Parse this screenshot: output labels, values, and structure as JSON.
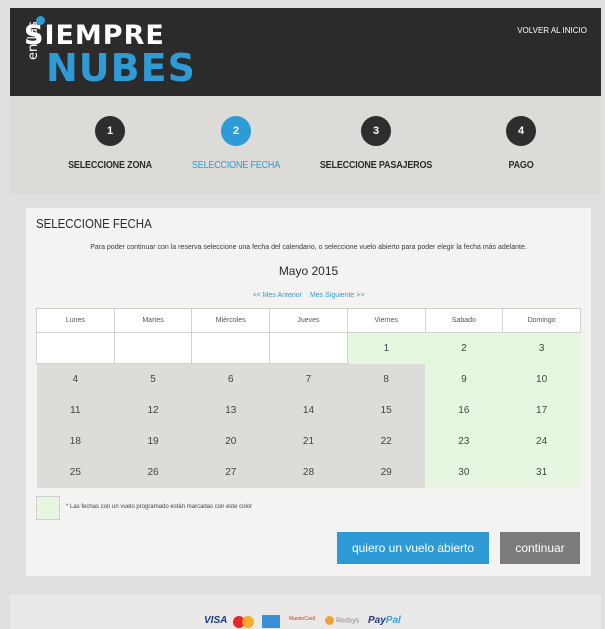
{
  "header": {
    "logo_line1": "SIEMPRE",
    "logo_small": "en las",
    "logo_line2": "NUBES",
    "back_link": "VOLVER AL INICIO"
  },
  "steps": [
    {
      "number": "1",
      "label": "SELECCIONE ZONA"
    },
    {
      "number": "2",
      "label": "SELECCIONE FECHA"
    },
    {
      "number": "3",
      "label": "SELECCIONE PASAJEROS"
    },
    {
      "number": "4",
      "label": "PAGO"
    }
  ],
  "card": {
    "title": "SELECCIONE FECHA",
    "description": "Para poder continuar con la reserva seleccione una fecha del calendario, o seleccione vuelo abierto para poder elegir la fecha más adelante.",
    "month": "Mayo 2015",
    "prev_month": "<< Mes Anterior",
    "next_month": "Mes Siguiente >>"
  },
  "calendar": {
    "weekdays": [
      "Lunes",
      "Martes",
      "Miércoles",
      "Jueves",
      "Viernes",
      "Sabado",
      "Domingo"
    ],
    "days": [
      "1",
      "2",
      "3",
      "4",
      "5",
      "6",
      "7",
      "8",
      "9",
      "10",
      "11",
      "12",
      "13",
      "14",
      "15",
      "16",
      "17",
      "18",
      "19",
      "20",
      "21",
      "22",
      "23",
      "24",
      "25",
      "26",
      "27",
      "28",
      "29",
      "30",
      "31"
    ]
  },
  "legend": {
    "text": "* Las fechas con un vuelo programado están marcadas con este color"
  },
  "buttons": {
    "open_flight": "quiero un vuelo abierto",
    "continue": "continuar"
  },
  "footer": {
    "visa": "VISA",
    "mastercard_small": "MasterCard",
    "redsys": "Redsys",
    "paypal_a": "Pay",
    "paypal_b": "Pal"
  },
  "colors": {
    "accent": "#2f9bd6",
    "header_bg": "#2b2b2b",
    "available_day": "#e7f6e1"
  }
}
